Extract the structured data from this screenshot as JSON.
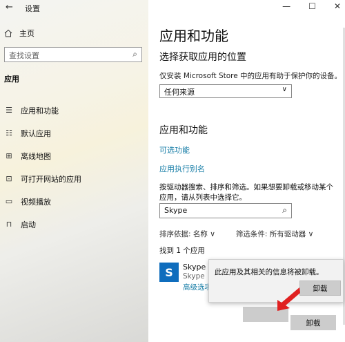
{
  "sidebar": {
    "title": "设置",
    "home": "主页",
    "search_placeholder": "查找设置",
    "section": "应用",
    "items": [
      {
        "label": "应用和功能",
        "icon": "list-icon"
      },
      {
        "label": "默认应用",
        "icon": "default-apps-icon"
      },
      {
        "label": "离线地图",
        "icon": "map-icon"
      },
      {
        "label": "可打开网站的应用",
        "icon": "open-web-icon"
      },
      {
        "label": "视频播放",
        "icon": "video-icon"
      },
      {
        "label": "启动",
        "icon": "startup-icon"
      }
    ]
  },
  "main": {
    "title": "应用和功能",
    "choose_heading": "选择获取应用的位置",
    "choose_desc": "仅安装 Microsoft Store 中的应用有助于保护你的设备。",
    "source_value": "任何来源",
    "apps_heading": "应用和功能",
    "link_optional": "可选功能",
    "link_alias": "应用执行别名",
    "search_desc": "按驱动器搜索、排序和筛选。如果想要卸载或移动某个应用，请从列表中选择它。",
    "search_value": "Skype",
    "sort_label": "排序依据: 名称",
    "filter_label": "筛选条件: 所有驱动器",
    "found": "找到 1 个应用",
    "app": {
      "name": "Skype",
      "publisher": "Skype",
      "advanced": "高级选项"
    }
  },
  "popup": {
    "message": "此应用及其相关的信息将被卸载。",
    "button": "卸载"
  },
  "bottom_button": "卸载",
  "colors": {
    "accent_link": "#1a7fa8",
    "app_icon": "#0f6dbd",
    "arrow": "#e02020"
  }
}
